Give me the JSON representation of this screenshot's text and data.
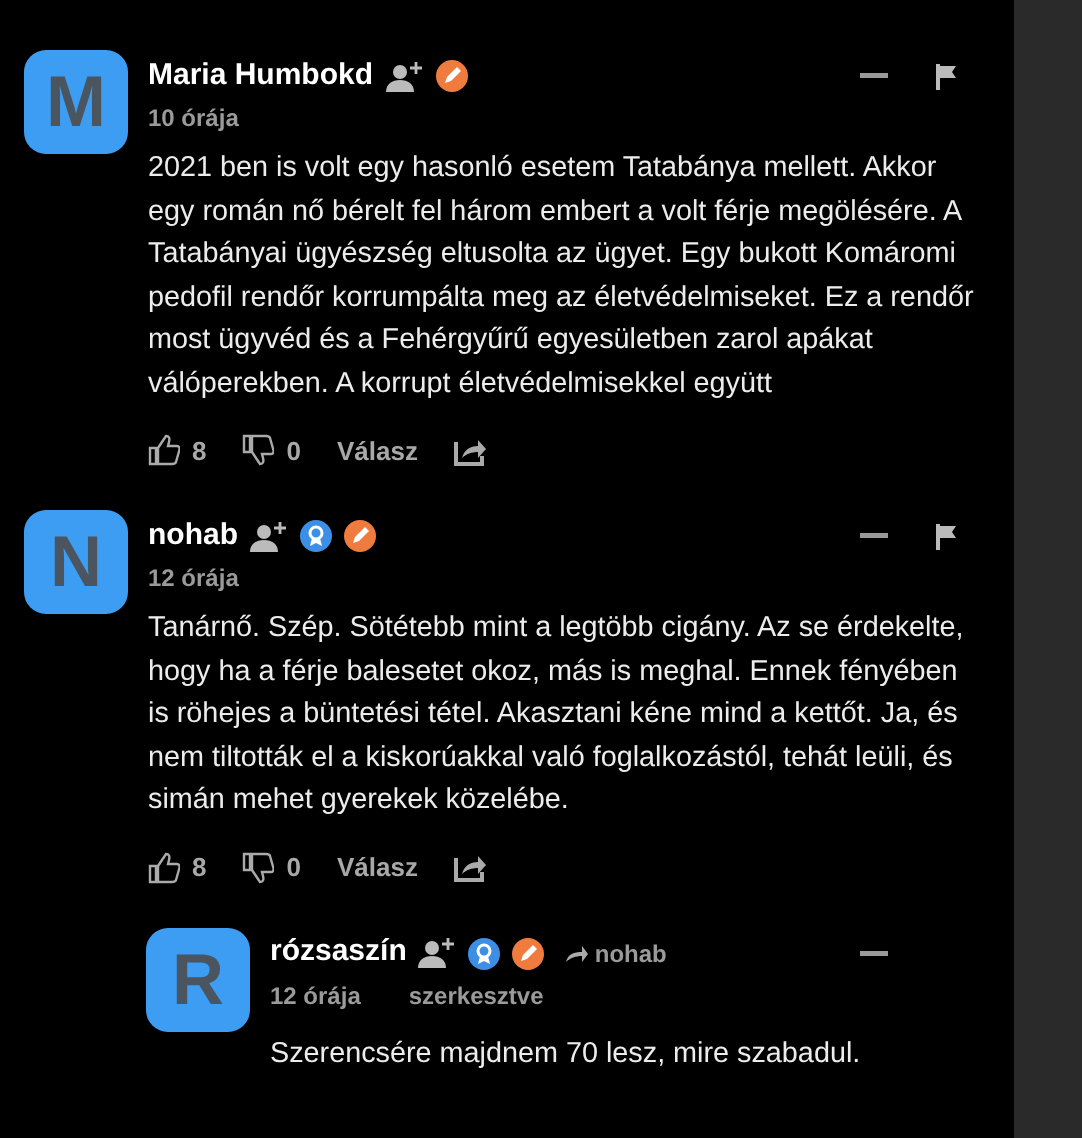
{
  "comments": [
    {
      "avatar": "M",
      "name": "Maria Humbokd",
      "badges": [
        {
          "kind": "follow"
        },
        {
          "kind": "pencil"
        }
      ],
      "time": "10 órája",
      "body": "2021 ben is volt egy hasonló esetem Tatabánya mellett. Akkor egy román nő bérelt fel három embert a volt férje megölésére. A Tatabányai ügyészség eltusolta az ügyet. Egy bukott Komáromi pedofil rendőr korrumpálta meg az életvédelmiseket. Ez a rendőr most ügyvéd és a Fehérgyűrű egyesületben zarol apákat válóperekben. A korrupt életvédelmisekkel együtt",
      "likes": "8",
      "dislikes": "0",
      "reply_label": "Válasz",
      "flag": true
    },
    {
      "avatar": "N",
      "name": "nohab",
      "badges": [
        {
          "kind": "follow"
        },
        {
          "kind": "ribbon"
        },
        {
          "kind": "pencil"
        }
      ],
      "time": "12 órája",
      "body": "Tanárnő. Szép. Sötétebb mint a legtöbb cigány. Az se érdekelte, hogy ha a férje balesetet okoz, más is meghal. Ennek fényében is röhejes a büntetési tétel. Akasztani kéne mind a kettőt. Ja, és nem tiltották el a kiskorúakkal való foglalkozástól, tehát leüli, és simán mehet gyerekek közelébe.",
      "likes": "8",
      "dislikes": "0",
      "reply_label": "Válasz",
      "flag": true,
      "children": [
        {
          "avatar": "R",
          "name": "rózsaszín",
          "badges": [
            {
              "kind": "follow"
            },
            {
              "kind": "ribbon"
            },
            {
              "kind": "pencil"
            }
          ],
          "reply_to": "nohab",
          "time": "12 órája",
          "edited": "szerkesztve",
          "body": "Szerencsére majdnem 70 lesz, mire szabadul.",
          "flag": false
        }
      ]
    }
  ]
}
